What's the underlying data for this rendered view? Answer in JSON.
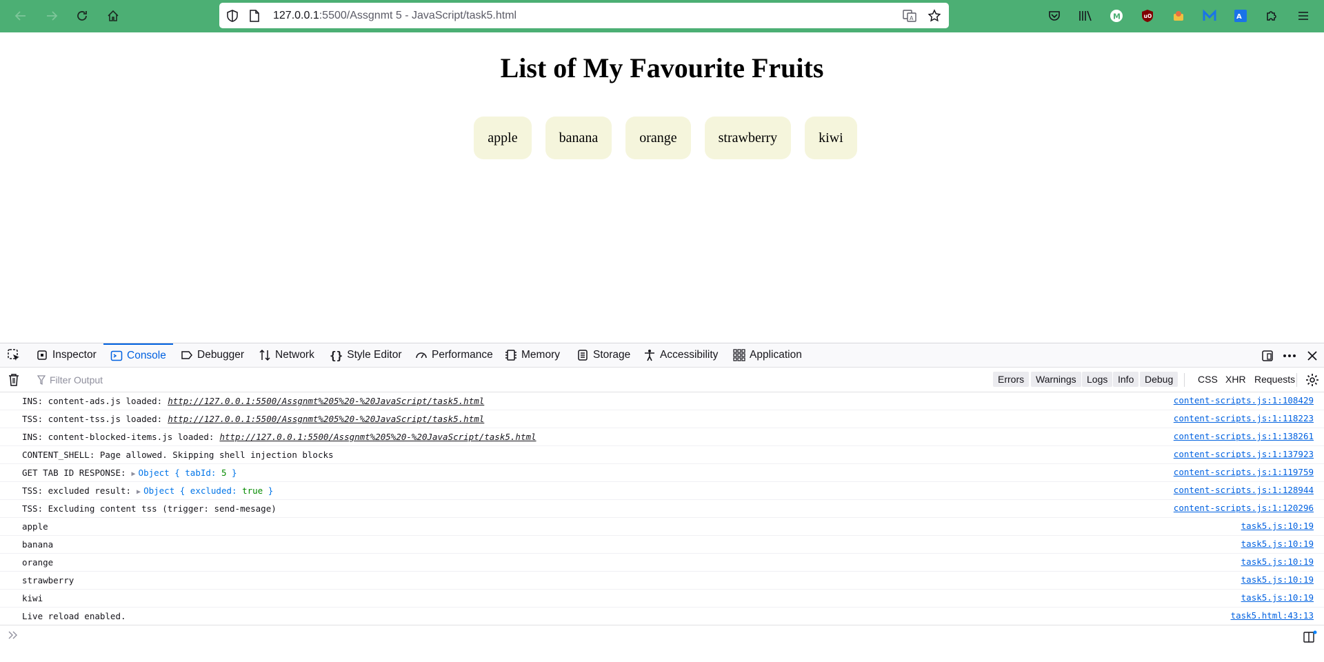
{
  "browser": {
    "url_host": "127.0.0.1",
    "url_rest": ":5500/Assgnmt 5 - JavaScript/task5.html"
  },
  "page": {
    "title": "List of My Favourite Fruits",
    "fruits": [
      "apple",
      "banana",
      "orange",
      "strawberry",
      "kiwi"
    ]
  },
  "devtools": {
    "tabs": [
      "Inspector",
      "Console",
      "Debugger",
      "Network",
      "Style Editor",
      "Performance",
      "Memory",
      "Storage",
      "Accessibility",
      "Application"
    ],
    "active_tab": "Console",
    "filter_placeholder": "Filter Output",
    "filter_buttons": [
      "Errors",
      "Warnings",
      "Logs",
      "Info",
      "Debug"
    ],
    "filter_plain": [
      "CSS",
      "XHR",
      "Requests"
    ],
    "logs": [
      {
        "text": "INS: content-ads.js loaded:",
        "link": "http://127.0.0.1:5500/Assgnmt%205%20-%20JavaScript/task5.html",
        "src": "content-scripts.js:1:108429"
      },
      {
        "text": "TSS: content-tss.js loaded:",
        "link": "http://127.0.0.1:5500/Assgnmt%205%20-%20JavaScript/task5.html",
        "src": "content-scripts.js:1:118223"
      },
      {
        "text": "INS: content-blocked-items.js loaded:",
        "link": "http://127.0.0.1:5500/Assgnmt%205%20-%20JavaScript/task5.html",
        "src": "content-scripts.js:1:138261"
      },
      {
        "text": "CONTENT_SHELL: Page allowed. Skipping shell injection blocks",
        "src": "content-scripts.js:1:137923"
      },
      {
        "text": "GET TAB ID RESPONSE:",
        "obj_key": "Object { tabId: ",
        "obj_val": "5",
        "obj_end": " }",
        "src": "content-scripts.js:1:119759"
      },
      {
        "text": "TSS: excluded result:",
        "obj_key": "Object { excluded: ",
        "obj_val": "true",
        "obj_end": " }",
        "src": "content-scripts.js:1:128944"
      },
      {
        "text": "TSS: Excluding content tss (trigger: send-mesage)",
        "src": "content-scripts.js:1:120296"
      },
      {
        "text": "apple",
        "src": "task5.js:10:19"
      },
      {
        "text": "banana",
        "src": "task5.js:10:19"
      },
      {
        "text": "orange",
        "src": "task5.js:10:19"
      },
      {
        "text": "strawberry",
        "src": "task5.js:10:19"
      },
      {
        "text": "kiwi",
        "src": "task5.js:10:19"
      },
      {
        "text": "Live reload enabled.",
        "src": "task5.html:43:13"
      }
    ]
  },
  "colors": {
    "toolbar": "#4caf74",
    "fruit_bg": "#f5f5dc",
    "devtools_accent": "#0061e0"
  },
  "icons": {
    "nav": [
      "back-arrow-icon",
      "forward-arrow-icon",
      "reload-icon",
      "home-icon"
    ],
    "url": [
      "shield-icon",
      "page-icon",
      "translate-icon",
      "star-icon"
    ],
    "toolbar_right": [
      "pocket-icon",
      "library-icon",
      "m-extension-icon",
      "ublock-icon",
      "extension-icon",
      "malwarebytes-icon",
      "translate-extension-icon",
      "puzzle-icon",
      "menu-icon"
    ]
  }
}
